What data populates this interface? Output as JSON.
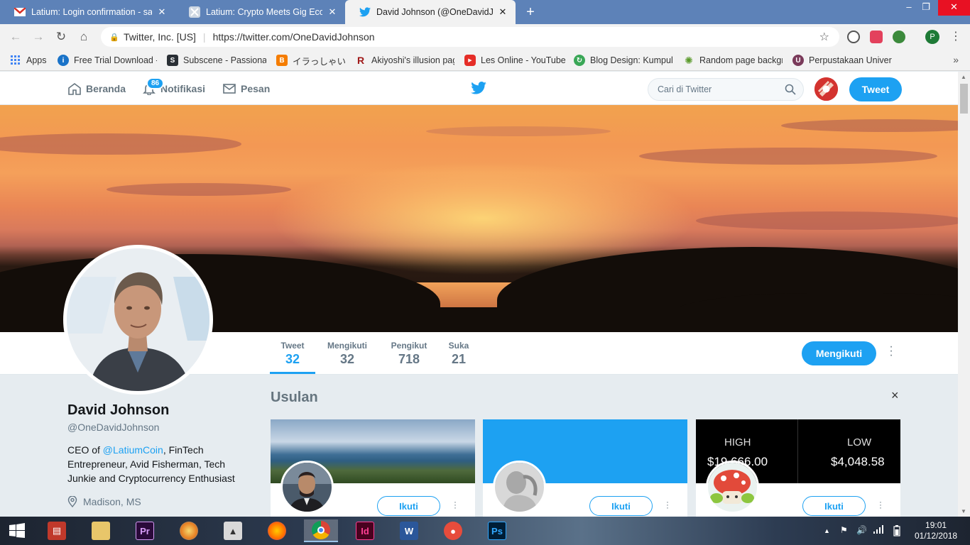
{
  "browser": {
    "tabs": [
      {
        "title": "Latium: Login confirmation - saji",
        "icon": "gmail-icon",
        "close": "✕"
      },
      {
        "title": "Latium: Crypto Meets Gig Econo",
        "icon": "latium-icon",
        "close": "✕"
      },
      {
        "title": "David Johnson (@OneDavidJohn",
        "icon": "twitter-icon",
        "close": "✕"
      }
    ],
    "new_tab": "+",
    "site_identity": "Twitter, Inc. [US]",
    "url": "https://twitter.com/OneDavidJohnson",
    "profile_initial": "P",
    "bookmarks": [
      {
        "label": "Apps",
        "color": "#4285f4"
      },
      {
        "label": "Free Trial Download -",
        "color": "#1a73c8"
      },
      {
        "label": "Subscene - Passionat",
        "color": "#2a2f35"
      },
      {
        "label": "イラっしゃいませ",
        "color": "#f57d00"
      },
      {
        "label": "Akiyoshi's illusion pag",
        "color": "#a01818"
      },
      {
        "label": "Les Online - YouTube",
        "color": "#e52d27"
      },
      {
        "label": "Blog Design: Kumpul",
        "color": "#3aa757"
      },
      {
        "label": "Random page backgr",
        "color": "#5a9a2a"
      },
      {
        "label": "Perpustakaan Univers",
        "color": "#7a3a5a"
      }
    ]
  },
  "twitter": {
    "nav": {
      "home": "Beranda",
      "notifications": "Notifikasi",
      "notifications_count": "86",
      "messages": "Pesan",
      "search_placeholder": "Cari di Twitter",
      "tweet_button": "Tweet"
    },
    "stats": [
      {
        "label": "Tweet",
        "value": "32",
        "active": true
      },
      {
        "label": "Mengikuti",
        "value": "32",
        "active": false
      },
      {
        "label": "Pengikut",
        "value": "718",
        "active": false
      },
      {
        "label": "Suka",
        "value": "21",
        "active": false
      }
    ],
    "follow_button": "Mengikuti",
    "profile": {
      "name": "David Johnson",
      "handle": "@OneDavidJohnson",
      "bio_prefix": "CEO of ",
      "bio_mention": "@LatiumCoin",
      "bio_suffix": ", FinTech Entrepreneur, Avid Fisherman, Tech Junkie and Cryptocurrency Enthusiast",
      "location": "Madison, MS"
    },
    "suggestions": {
      "title": "Usulan",
      "close": "×",
      "cards": [
        {
          "follow_label": "Ikuti"
        },
        {
          "follow_label": "Ikuti",
          "cover_color": "#1da1f2"
        },
        {
          "follow_label": "Ikuti",
          "high_label": "HIGH",
          "high_value": "$19,666.00",
          "low_label": "LOW",
          "low_value": "$4,048.58"
        }
      ]
    }
  },
  "taskbar": {
    "apps": [
      "file-explorer-icon",
      "premiere-icon",
      "paint-icon",
      "media-icon",
      "firefox-icon",
      "chrome-icon",
      "indesign-icon",
      "word-icon",
      "screenshot-icon",
      "photoshop-icon"
    ],
    "time": "19:01",
    "date": "01/12/2018"
  },
  "colors": {
    "twitter_blue": "#1da1f2",
    "chrome_tabstrip": "#5d82b8"
  }
}
